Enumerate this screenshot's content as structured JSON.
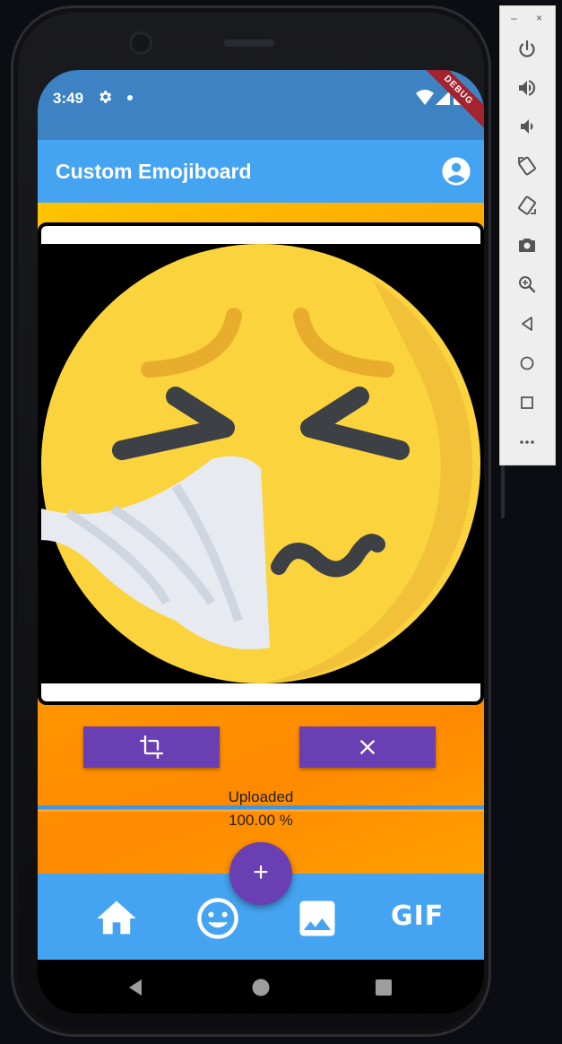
{
  "status_bar": {
    "time": "3:49"
  },
  "debug_banner": "DEBUG",
  "app_bar": {
    "title": "Custom Emojiboard",
    "account_icon": "account-circle-icon"
  },
  "editor": {
    "image_subject": "sneezing-face-emoji",
    "crop_icon": "crop-icon",
    "close_icon": "close-icon"
  },
  "upload": {
    "status_label": "Uploaded",
    "percent_text": "100.00 %",
    "progress": 1.0
  },
  "fab": {
    "label": "+"
  },
  "bottom_nav": {
    "items": [
      {
        "icon": "home-icon"
      },
      {
        "icon": "emoji-icon"
      },
      {
        "icon": "image-icon"
      },
      {
        "icon": "gif-icon",
        "label": "GIF"
      }
    ]
  },
  "system_nav": {
    "icons": [
      "back-icon",
      "home-circle-icon",
      "overview-icon"
    ]
  },
  "emulator_toolbar": {
    "minimize": "–",
    "close": "×",
    "icons": [
      "power-icon",
      "volume-up-icon",
      "volume-down-icon",
      "rotate-left-icon",
      "rotate-right-icon",
      "camera-icon",
      "zoom-icon",
      "back-icon",
      "home-icon",
      "overview-icon",
      "more-icon"
    ]
  },
  "colors": {
    "app_bar": "#45a4f2",
    "status_bar": "#3d83c4",
    "accent": "#6a3fb3",
    "background_orange": "#ff9800"
  }
}
